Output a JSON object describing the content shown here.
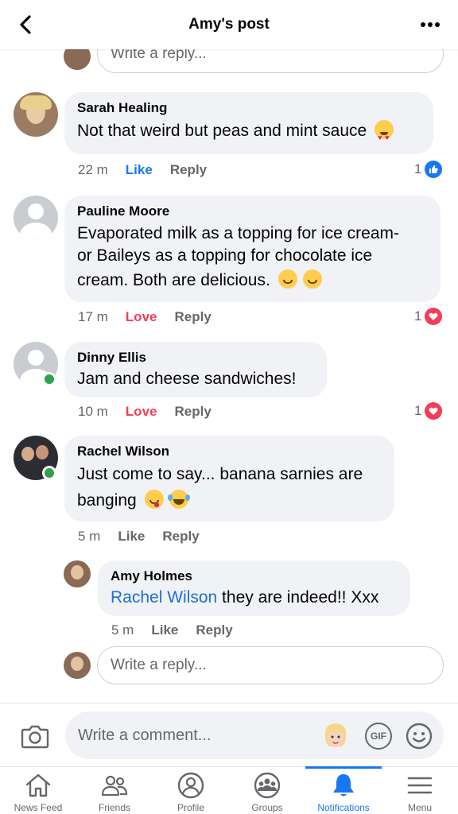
{
  "header": {
    "title": "Amy's post"
  },
  "reply_placeholder": "Write a reply...",
  "comments": [
    {
      "name": "Sarah Healing",
      "text": "Not that weird but peas and mint sauce",
      "emoji": "heart-eyes",
      "time": "22 m",
      "action": "Like",
      "reply": "Reply",
      "reaction_count": "1",
      "reaction_type": "like"
    },
    {
      "name": "Pauline Moore",
      "text_lines": [
        "Evaporated milk as a topping for ice cream-",
        "or Baileys as a topping for chocolate ice",
        "cream. Both are delicious."
      ],
      "time": "17 m",
      "action": "Love",
      "reply": "Reply",
      "reaction_count": "1",
      "reaction_type": "love"
    },
    {
      "name": "Dinny Ellis",
      "text": "Jam and cheese sandwiches!",
      "time": "10 m",
      "action": "Love",
      "reply": "Reply",
      "reaction_count": "1",
      "reaction_type": "love"
    },
    {
      "name": "Rachel Wilson",
      "text_lines": [
        "Just come to say... banana sarnies are",
        "banging"
      ],
      "time": "5 m",
      "action": "Like",
      "reply": "Reply"
    }
  ],
  "nested_reply": {
    "name": "Amy Holmes",
    "mention": "Rachel Wilson",
    "text": " they are indeed!! Xxx",
    "time": "5 m",
    "action": "Like",
    "reply": "Reply"
  },
  "composer": {
    "placeholder": "Write a comment...",
    "gif_label": "GIF"
  },
  "nav": [
    {
      "label": "News Feed",
      "icon": "home-icon"
    },
    {
      "label": "Friends",
      "icon": "friends-icon"
    },
    {
      "label": "Profile",
      "icon": "profile-icon"
    },
    {
      "label": "Groups",
      "icon": "groups-icon"
    },
    {
      "label": "Notifications",
      "icon": "bell-icon",
      "active": true
    },
    {
      "label": "Menu",
      "icon": "menu-icon"
    }
  ],
  "colors": {
    "accent": "#1877f2",
    "love": "#f33e58",
    "online": "#31a24c",
    "bubble": "#f0f2f5"
  }
}
